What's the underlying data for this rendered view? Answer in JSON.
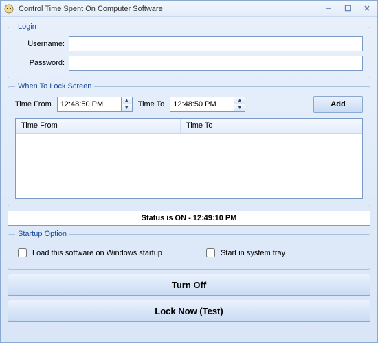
{
  "window": {
    "title": "Control Time Spent On Computer Software"
  },
  "login": {
    "legend": "Login",
    "username_label": "Username:",
    "username_value": "",
    "password_label": "Password:",
    "password_value": ""
  },
  "lockscreen": {
    "legend": "When To Lock Screen",
    "time_from_label": "Time From",
    "time_from_value": "12:48:50 PM",
    "time_to_label": "Time To",
    "time_to_value": "12:48:50 PM",
    "add_label": "Add",
    "col_from": "Time From",
    "col_to": "Time To",
    "rows": []
  },
  "status": {
    "text": "Status is ON - 12:49:10 PM"
  },
  "startup": {
    "legend": "Startup Option",
    "opt1_label": "Load this software on Windows startup",
    "opt1_checked": false,
    "opt2_label": "Start in system tray",
    "opt2_checked": false
  },
  "buttons": {
    "turn_off": "Turn Off",
    "lock_now": "Lock Now (Test)"
  }
}
